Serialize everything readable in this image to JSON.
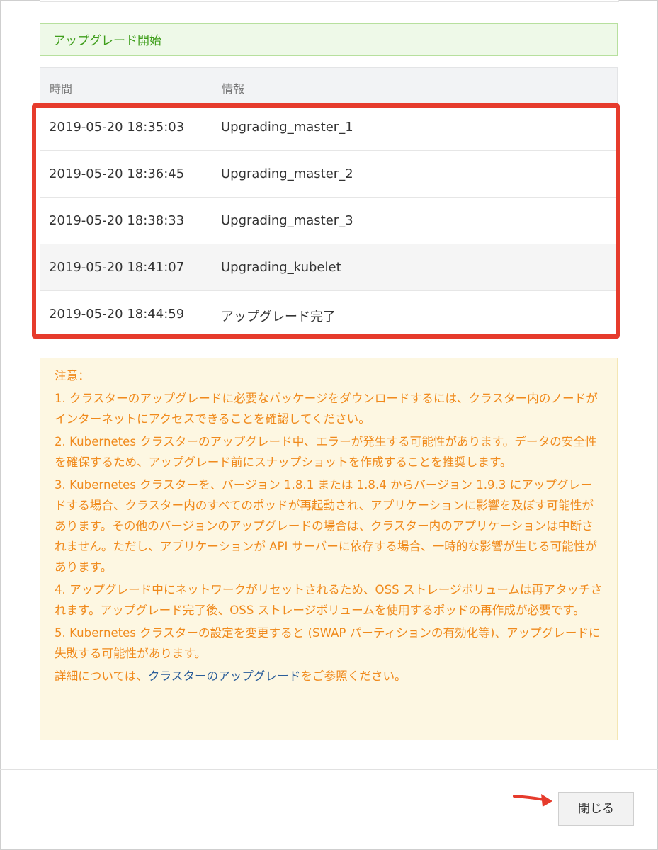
{
  "banner": {
    "text": "アップグレード開始"
  },
  "table": {
    "headers": {
      "time": "時間",
      "info": "情報"
    },
    "rows": [
      {
        "time": "2019-05-20 18:35:03",
        "info": "Upgrading_master_1"
      },
      {
        "time": "2019-05-20 18:36:45",
        "info": "Upgrading_master_2"
      },
      {
        "time": "2019-05-20 18:38:33",
        "info": "Upgrading_master_3"
      },
      {
        "time": "2019-05-20 18:41:07",
        "info": "Upgrading_kubelet"
      },
      {
        "time": "2019-05-20 18:44:59",
        "info": "アップグレード完了"
      }
    ]
  },
  "notes": {
    "title": "注意：",
    "items": [
      "1. クラスターのアップグレードに必要なパッケージをダウンロードするには、クラスター内のノードがインターネットにアクセスできることを確認してください。",
      "2. Kubernetes クラスターのアップグレード中、エラーが発生する可能性があります。データの安全性を確保するため、アップグレード前にスナップショットを作成することを推奨します。",
      "3. Kubernetes クラスターを、バージョン 1.8.1 または 1.8.4 からバージョン 1.9.3 にアップグレードする場合、クラスター内のすべてのポッドが再起動され、アプリケーションに影響を及ぼす可能性があります。その他のバージョンのアップグレードの場合は、クラスター内のアプリケーションは中断されません。ただし、アプリケーションが API サーバーに依存する場合、一時的な影響が生じる可能性があります。",
      "4. アップグレード中にネットワークがリセットされるため、OSS ストレージボリュームは再アタッチされます。アップグレード完了後、OSS ストレージボリュームを使用するポッドの再作成が必要です。",
      "5. Kubernetes クラスターの設定を変更すると (SWAP パーティションの有効化等)、アップグレードに失敗する可能性があります。"
    ],
    "more_prefix": "詳細については、",
    "more_link": "クラスターのアップグレード",
    "more_suffix": "をご参照ください。"
  },
  "footer": {
    "close_label": "閉じる"
  },
  "colors": {
    "highlight": "#e63b2c",
    "banner_text": "#3f9e1b",
    "note_text": "#f08a1c",
    "link": "#2a5d9a"
  }
}
